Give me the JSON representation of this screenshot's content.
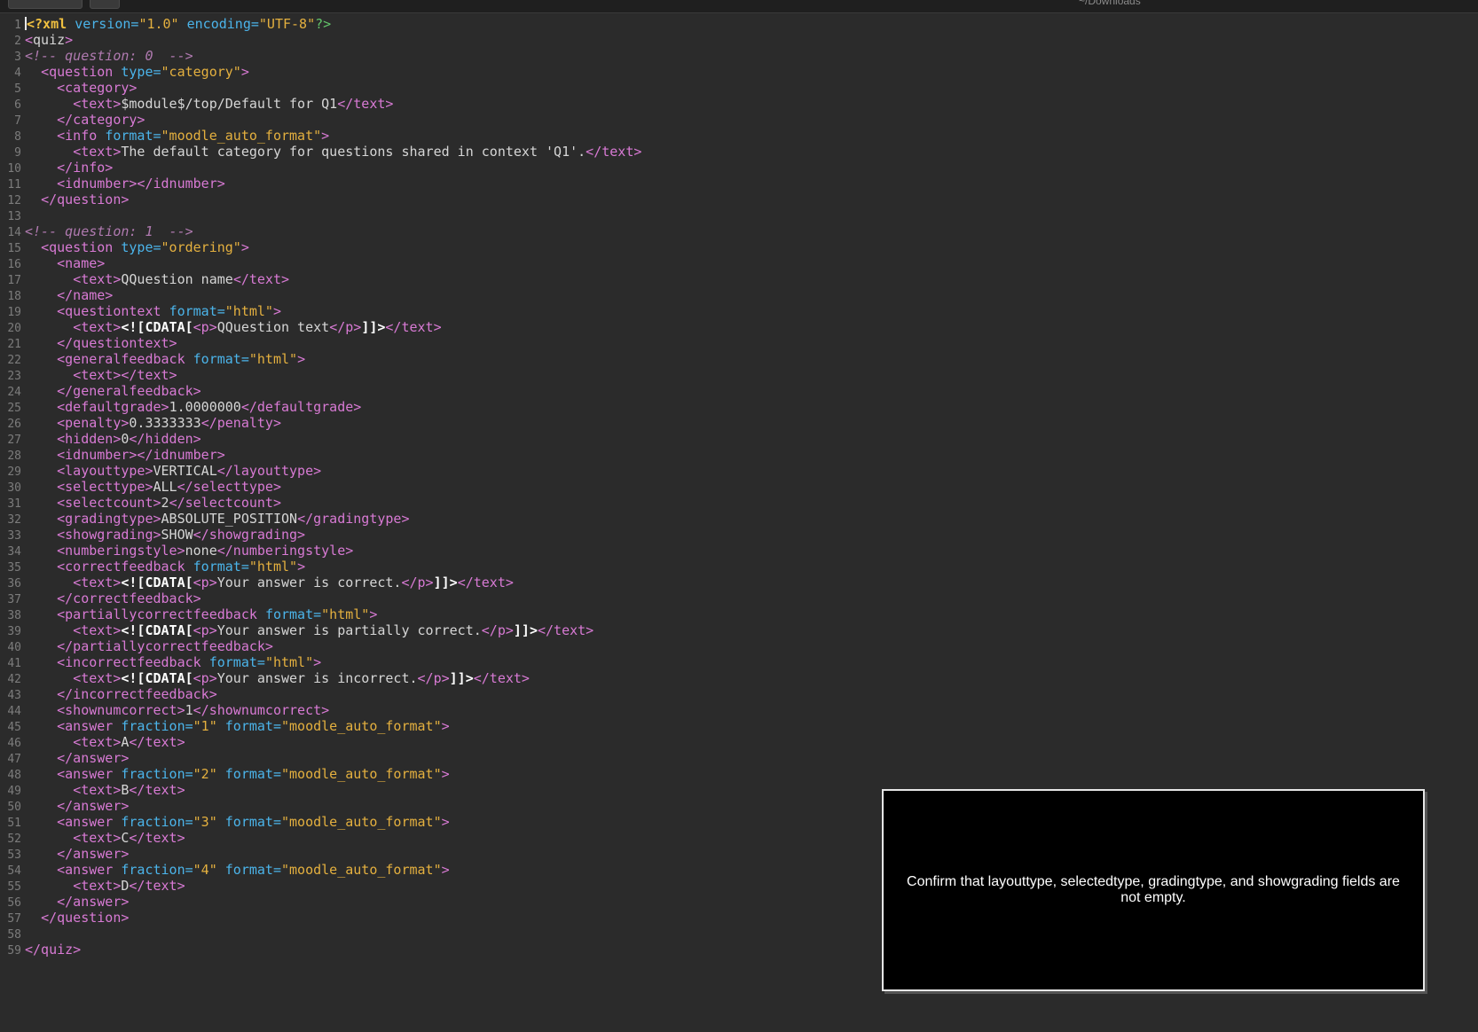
{
  "window": {
    "path": "~/Downloads"
  },
  "editor": {
    "lines": [
      [
        [
          "p",
          "<?xml "
        ],
        [
          "a",
          "version="
        ],
        [
          "v",
          "\"1.0\" "
        ],
        [
          "a",
          "encoding="
        ],
        [
          "v",
          "\"UTF-8\""
        ],
        [
          "g",
          "?>"
        ]
      ],
      [
        [
          "t",
          "<"
        ],
        [
          "tx",
          "quiz"
        ],
        [
          "t",
          ">"
        ]
      ],
      [
        [
          "c",
          "<!-- question: 0  -->"
        ]
      ],
      [
        [
          "tx",
          "  "
        ],
        [
          "t",
          "<question "
        ],
        [
          "a",
          "type="
        ],
        [
          "v",
          "\"category\""
        ],
        [
          "t",
          ">"
        ]
      ],
      [
        [
          "tx",
          "    "
        ],
        [
          "t",
          "<category>"
        ]
      ],
      [
        [
          "tx",
          "      "
        ],
        [
          "t",
          "<text>"
        ],
        [
          "tx",
          "$module$/top/Default for Q1"
        ],
        [
          "t",
          "</text>"
        ]
      ],
      [
        [
          "tx",
          "    "
        ],
        [
          "t",
          "</category>"
        ]
      ],
      [
        [
          "tx",
          "    "
        ],
        [
          "t",
          "<info "
        ],
        [
          "a",
          "format="
        ],
        [
          "v",
          "\"moodle_auto_format\""
        ],
        [
          "t",
          ">"
        ]
      ],
      [
        [
          "tx",
          "      "
        ],
        [
          "t",
          "<text>"
        ],
        [
          "tx",
          "The default category for questions shared in context 'Q1'."
        ],
        [
          "t",
          "</text>"
        ]
      ],
      [
        [
          "tx",
          "    "
        ],
        [
          "t",
          "</info>"
        ]
      ],
      [
        [
          "tx",
          "    "
        ],
        [
          "t",
          "<idnumber></idnumber>"
        ]
      ],
      [
        [
          "tx",
          "  "
        ],
        [
          "t",
          "</question>"
        ]
      ],
      [],
      [
        [
          "c",
          "<!-- question: 1  -->"
        ]
      ],
      [
        [
          "tx",
          "  "
        ],
        [
          "t",
          "<question "
        ],
        [
          "a",
          "type="
        ],
        [
          "v",
          "\"ordering\""
        ],
        [
          "t",
          ">"
        ]
      ],
      [
        [
          "tx",
          "    "
        ],
        [
          "t",
          "<name>"
        ]
      ],
      [
        [
          "tx",
          "      "
        ],
        [
          "t",
          "<text>"
        ],
        [
          "tx",
          "QQuestion name"
        ],
        [
          "t",
          "</text>"
        ]
      ],
      [
        [
          "tx",
          "    "
        ],
        [
          "t",
          "</name>"
        ]
      ],
      [
        [
          "tx",
          "    "
        ],
        [
          "t",
          "<questiontext "
        ],
        [
          "a",
          "format="
        ],
        [
          "v",
          "\"html\""
        ],
        [
          "t",
          ">"
        ]
      ],
      [
        [
          "tx",
          "      "
        ],
        [
          "t",
          "<text>"
        ],
        [
          "cd",
          "<![CDATA["
        ],
        [
          "t",
          "<p>"
        ],
        [
          "tx",
          "QQuestion text"
        ],
        [
          "t",
          "</p>"
        ],
        [
          "cd",
          "]]>"
        ],
        [
          "t",
          "</text>"
        ]
      ],
      [
        [
          "tx",
          "    "
        ],
        [
          "t",
          "</questiontext>"
        ]
      ],
      [
        [
          "tx",
          "    "
        ],
        [
          "t",
          "<generalfeedback "
        ],
        [
          "a",
          "format="
        ],
        [
          "v",
          "\"html\""
        ],
        [
          "t",
          ">"
        ]
      ],
      [
        [
          "tx",
          "      "
        ],
        [
          "t",
          "<text></text>"
        ]
      ],
      [
        [
          "tx",
          "    "
        ],
        [
          "t",
          "</generalfeedback>"
        ]
      ],
      [
        [
          "tx",
          "    "
        ],
        [
          "t",
          "<defaultgrade>"
        ],
        [
          "tx",
          "1.0000000"
        ],
        [
          "t",
          "</defaultgrade>"
        ]
      ],
      [
        [
          "tx",
          "    "
        ],
        [
          "t",
          "<penalty>"
        ],
        [
          "tx",
          "0.3333333"
        ],
        [
          "t",
          "</penalty>"
        ]
      ],
      [
        [
          "tx",
          "    "
        ],
        [
          "t",
          "<hidden>"
        ],
        [
          "tx",
          "0"
        ],
        [
          "t",
          "</hidden>"
        ]
      ],
      [
        [
          "tx",
          "    "
        ],
        [
          "t",
          "<idnumber></idnumber>"
        ]
      ],
      [
        [
          "tx",
          "    "
        ],
        [
          "t",
          "<layouttype>"
        ],
        [
          "tx",
          "VERTICAL"
        ],
        [
          "t",
          "</layouttype>"
        ]
      ],
      [
        [
          "tx",
          "    "
        ],
        [
          "t",
          "<selecttype>"
        ],
        [
          "tx",
          "ALL"
        ],
        [
          "t",
          "</selecttype>"
        ]
      ],
      [
        [
          "tx",
          "    "
        ],
        [
          "t",
          "<selectcount>"
        ],
        [
          "tx",
          "2"
        ],
        [
          "t",
          "</selectcount>"
        ]
      ],
      [
        [
          "tx",
          "    "
        ],
        [
          "t",
          "<gradingtype>"
        ],
        [
          "tx",
          "ABSOLUTE_POSITION"
        ],
        [
          "t",
          "</gradingtype>"
        ]
      ],
      [
        [
          "tx",
          "    "
        ],
        [
          "t",
          "<showgrading>"
        ],
        [
          "tx",
          "SHOW"
        ],
        [
          "t",
          "</showgrading>"
        ]
      ],
      [
        [
          "tx",
          "    "
        ],
        [
          "t",
          "<numberingstyle>"
        ],
        [
          "tx",
          "none"
        ],
        [
          "t",
          "</numberingstyle>"
        ]
      ],
      [
        [
          "tx",
          "    "
        ],
        [
          "t",
          "<correctfeedback "
        ],
        [
          "a",
          "format="
        ],
        [
          "v",
          "\"html\""
        ],
        [
          "t",
          ">"
        ]
      ],
      [
        [
          "tx",
          "      "
        ],
        [
          "t",
          "<text>"
        ],
        [
          "cd",
          "<![CDATA["
        ],
        [
          "t",
          "<p>"
        ],
        [
          "tx",
          "Your answer is correct."
        ],
        [
          "t",
          "</p>"
        ],
        [
          "cd",
          "]]>"
        ],
        [
          "t",
          "</text>"
        ]
      ],
      [
        [
          "tx",
          "    "
        ],
        [
          "t",
          "</correctfeedback>"
        ]
      ],
      [
        [
          "tx",
          "    "
        ],
        [
          "t",
          "<partiallycorrectfeedback "
        ],
        [
          "a",
          "format="
        ],
        [
          "v",
          "\"html\""
        ],
        [
          "t",
          ">"
        ]
      ],
      [
        [
          "tx",
          "      "
        ],
        [
          "t",
          "<text>"
        ],
        [
          "cd",
          "<![CDATA["
        ],
        [
          "t",
          "<p>"
        ],
        [
          "tx",
          "Your answer is partially correct."
        ],
        [
          "t",
          "</p>"
        ],
        [
          "cd",
          "]]>"
        ],
        [
          "t",
          "</text>"
        ]
      ],
      [
        [
          "tx",
          "    "
        ],
        [
          "t",
          "</partiallycorrectfeedback>"
        ]
      ],
      [
        [
          "tx",
          "    "
        ],
        [
          "t",
          "<incorrectfeedback "
        ],
        [
          "a",
          "format="
        ],
        [
          "v",
          "\"html\""
        ],
        [
          "t",
          ">"
        ]
      ],
      [
        [
          "tx",
          "      "
        ],
        [
          "t",
          "<text>"
        ],
        [
          "cd",
          "<![CDATA["
        ],
        [
          "t",
          "<p>"
        ],
        [
          "tx",
          "Your answer is incorrect."
        ],
        [
          "t",
          "</p>"
        ],
        [
          "cd",
          "]]>"
        ],
        [
          "t",
          "</text>"
        ]
      ],
      [
        [
          "tx",
          "    "
        ],
        [
          "t",
          "</incorrectfeedback>"
        ]
      ],
      [
        [
          "tx",
          "    "
        ],
        [
          "t",
          "<shownumcorrect>"
        ],
        [
          "tx",
          "1"
        ],
        [
          "t",
          "</shownumcorrect>"
        ]
      ],
      [
        [
          "tx",
          "    "
        ],
        [
          "t",
          "<answer "
        ],
        [
          "a",
          "fraction="
        ],
        [
          "v",
          "\"1\" "
        ],
        [
          "a",
          "format="
        ],
        [
          "v",
          "\"moodle_auto_format\""
        ],
        [
          "t",
          ">"
        ]
      ],
      [
        [
          "tx",
          "      "
        ],
        [
          "t",
          "<text>"
        ],
        [
          "tx",
          "A"
        ],
        [
          "t",
          "</text>"
        ]
      ],
      [
        [
          "tx",
          "    "
        ],
        [
          "t",
          "</answer>"
        ]
      ],
      [
        [
          "tx",
          "    "
        ],
        [
          "t",
          "<answer "
        ],
        [
          "a",
          "fraction="
        ],
        [
          "v",
          "\"2\" "
        ],
        [
          "a",
          "format="
        ],
        [
          "v",
          "\"moodle_auto_format\""
        ],
        [
          "t",
          ">"
        ]
      ],
      [
        [
          "tx",
          "      "
        ],
        [
          "t",
          "<text>"
        ],
        [
          "tx",
          "B"
        ],
        [
          "t",
          "</text>"
        ]
      ],
      [
        [
          "tx",
          "    "
        ],
        [
          "t",
          "</answer>"
        ]
      ],
      [
        [
          "tx",
          "    "
        ],
        [
          "t",
          "<answer "
        ],
        [
          "a",
          "fraction="
        ],
        [
          "v",
          "\"3\" "
        ],
        [
          "a",
          "format="
        ],
        [
          "v",
          "\"moodle_auto_format\""
        ],
        [
          "t",
          ">"
        ]
      ],
      [
        [
          "tx",
          "      "
        ],
        [
          "t",
          "<text>"
        ],
        [
          "tx",
          "C"
        ],
        [
          "t",
          "</text>"
        ]
      ],
      [
        [
          "tx",
          "    "
        ],
        [
          "t",
          "</answer>"
        ]
      ],
      [
        [
          "tx",
          "    "
        ],
        [
          "t",
          "<answer "
        ],
        [
          "a",
          "fraction="
        ],
        [
          "v",
          "\"4\" "
        ],
        [
          "a",
          "format="
        ],
        [
          "v",
          "\"moodle_auto_format\""
        ],
        [
          "t",
          ">"
        ]
      ],
      [
        [
          "tx",
          "      "
        ],
        [
          "t",
          "<text>"
        ],
        [
          "tx",
          "D"
        ],
        [
          "t",
          "</text>"
        ]
      ],
      [
        [
          "tx",
          "    "
        ],
        [
          "t",
          "</answer>"
        ]
      ],
      [
        [
          "tx",
          "  "
        ],
        [
          "t",
          "</question>"
        ]
      ],
      [],
      [
        [
          "t",
          "</quiz>"
        ]
      ]
    ]
  },
  "tooltip": {
    "text": "Confirm that layouttype, selectedtype, gradingtype, and showgrading fields are not empty."
  }
}
